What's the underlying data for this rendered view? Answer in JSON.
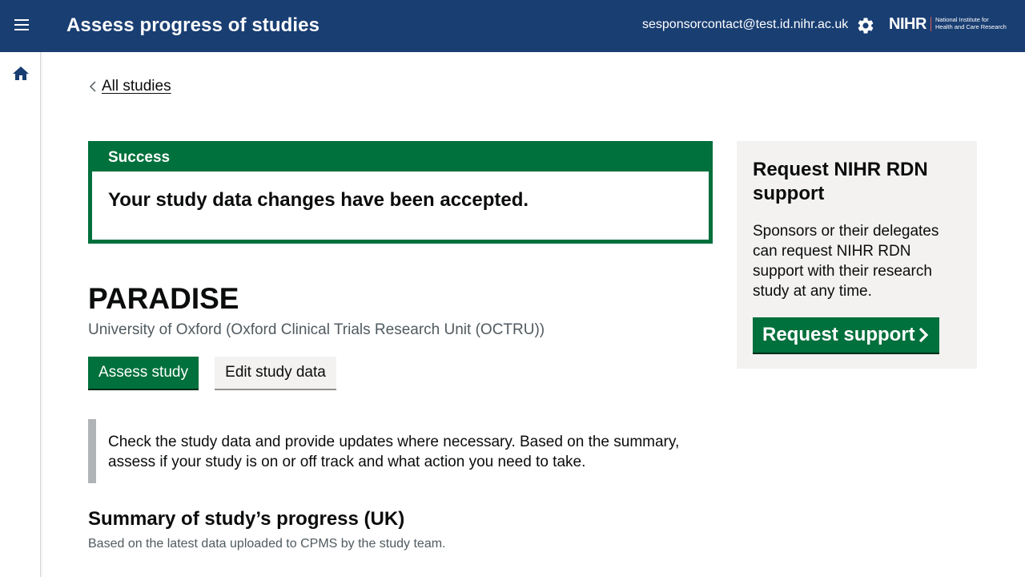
{
  "header": {
    "app_title": "Assess progress of studies",
    "user_email": "sesponsorcontact@test.id.nihr.ac.uk",
    "menu_icon": "hamburger-icon",
    "settings_icon": "gear-icon",
    "logo": {
      "main": "NIHR",
      "sub_line1": "National Institute for",
      "sub_line2": "Health and Care Research"
    },
    "bg_color": "#193e72"
  },
  "sidebar": {
    "home_icon": "home-icon"
  },
  "breadcrumb": {
    "back_label": "All studies"
  },
  "banner": {
    "title": "Success",
    "message": "Your study data changes have been accepted.",
    "color": "#00703c"
  },
  "study": {
    "title": "PARADISE",
    "organisation": "University of Oxford (Oxford Clinical Trials Research Unit (OCTRU))"
  },
  "actions": {
    "assess_label": "Assess study",
    "edit_label": "Edit study data"
  },
  "inset": {
    "text": "Check the study data and provide updates where necessary. Based on the summary, assess if your study is on or off track and what action you need to take."
  },
  "summary": {
    "heading": "Summary of study’s progress (UK)",
    "subtext": "Based on the latest data uploaded to CPMS by the study team."
  },
  "aside": {
    "heading": "Request NIHR RDN support",
    "body": "Sponsors or their delegates can request NIHR RDN support with their research study at any time.",
    "button_label": "Request support"
  }
}
